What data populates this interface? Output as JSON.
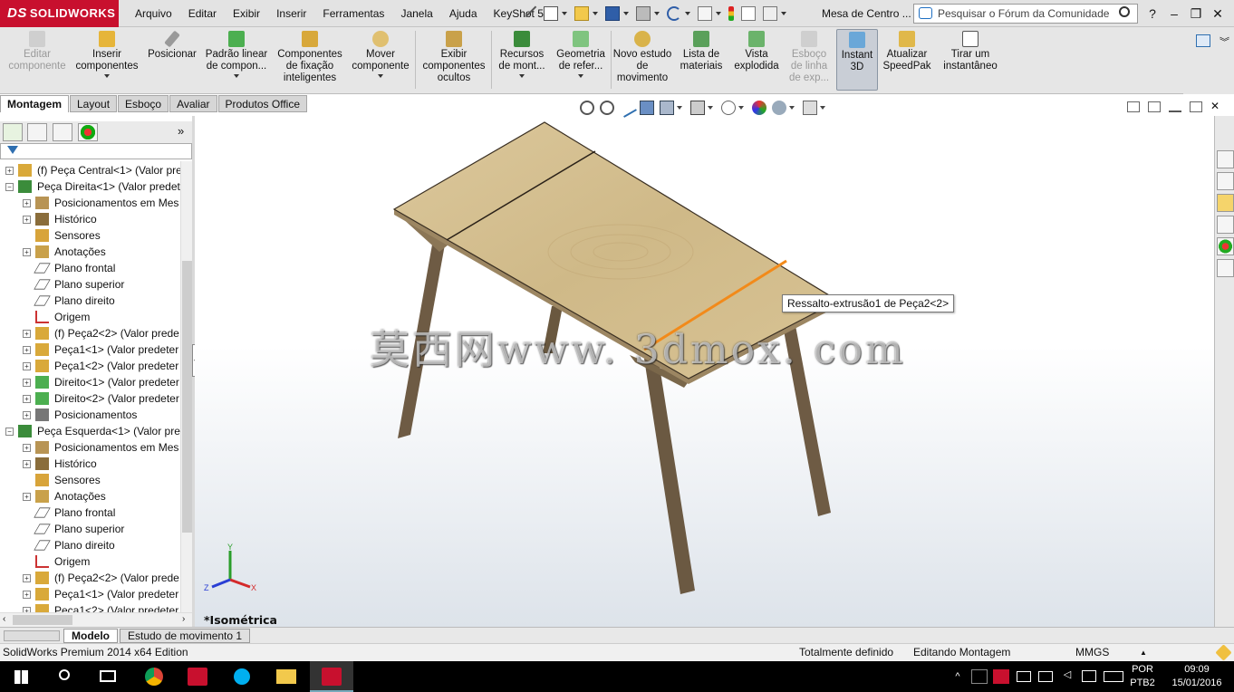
{
  "app": {
    "brand": "SOLIDWORKS",
    "brand_mark": "DS",
    "brand_color": "#c8102e"
  },
  "menu": [
    "Arquivo",
    "Editar",
    "Exibir",
    "Inserir",
    "Ferramentas",
    "Janela",
    "Ajuda",
    "KeyShot 5"
  ],
  "document_title": "Mesa de Centro ...",
  "search": {
    "placeholder": "Pesquisar o Fórum da Comunidade"
  },
  "command_manager": [
    {
      "label": "Editar componente",
      "icon": "edit-component-icon",
      "enabled": false
    },
    {
      "label": "Inserir componentes",
      "icon": "insert-components-icon",
      "enabled": true
    },
    {
      "label": "Posicionar",
      "icon": "mate-icon",
      "enabled": true
    },
    {
      "label": "Padrão linear de compon...",
      "icon": "linear-pattern-icon",
      "enabled": true
    },
    {
      "label": "Componentes de fixação inteligentes",
      "icon": "smart-fasteners-icon",
      "enabled": true
    },
    {
      "label": "Mover componente",
      "icon": "move-component-icon",
      "enabled": true
    },
    {
      "label": "Exibir componentes ocultos",
      "icon": "show-hidden-icon",
      "enabled": true
    },
    {
      "label": "Recursos de mont...",
      "icon": "assembly-features-icon",
      "enabled": true
    },
    {
      "label": "Geometria de refer...",
      "icon": "reference-geometry-icon",
      "enabled": true
    },
    {
      "label": "Novo estudo de movimento",
      "icon": "motion-study-icon",
      "enabled": true
    },
    {
      "label": "Lista de materiais",
      "icon": "bom-icon",
      "enabled": true
    },
    {
      "label": "Vista explodida",
      "icon": "exploded-view-icon",
      "enabled": true
    },
    {
      "label": "Esboço de linha de exp...",
      "icon": "explode-line-sketch-icon",
      "enabled": false
    },
    {
      "label": "Instant 3D",
      "icon": "instant3d-icon",
      "enabled": true,
      "active": true
    },
    {
      "label": "Atualizar SpeedPak",
      "icon": "speedpak-icon",
      "enabled": true
    },
    {
      "label": "Tirar um instantâneo",
      "icon": "snapshot-icon",
      "enabled": true
    }
  ],
  "tabs": [
    "Montagem",
    "Layout",
    "Esboço",
    "Avaliar",
    "Produtos Office"
  ],
  "active_tab": "Montagem",
  "tree": [
    {
      "label": "(f) Peça Central<1> (Valor pre",
      "level": 0,
      "icon": "part-icon"
    },
    {
      "label": "Peça Direita<1> (Valor predet",
      "level": 0,
      "icon": "subassembly-icon",
      "expanded": true
    },
    {
      "label": "Posicionamentos em Mes",
      "level": 1,
      "icon": "mates-folder-icon"
    },
    {
      "label": "Histórico",
      "level": 1,
      "icon": "history-icon"
    },
    {
      "label": "Sensores",
      "level": 1,
      "icon": "sensor-icon"
    },
    {
      "label": "Anotações",
      "level": 1,
      "icon": "annotations-icon"
    },
    {
      "label": "Plano frontal",
      "level": 1,
      "icon": "plane-icon"
    },
    {
      "label": "Plano superior",
      "level": 1,
      "icon": "plane-icon"
    },
    {
      "label": "Plano direito",
      "level": 1,
      "icon": "plane-icon"
    },
    {
      "label": "Origem",
      "level": 1,
      "icon": "origin-icon"
    },
    {
      "label": "(f) Peça2<2> (Valor prede",
      "level": 1,
      "icon": "part-icon"
    },
    {
      "label": "Peça1<1> (Valor predeter",
      "level": 1,
      "icon": "part-icon"
    },
    {
      "label": "Peça1<2> (Valor predeter",
      "level": 1,
      "icon": "part-icon"
    },
    {
      "label": "Direito<1> (Valor predeter",
      "level": 1,
      "icon": "part-green-icon"
    },
    {
      "label": "Direito<2> (Valor predeter",
      "level": 1,
      "icon": "part-green-icon"
    },
    {
      "label": "Posicionamentos",
      "level": 1,
      "icon": "mates-icon"
    },
    {
      "label": "Peça Esquerda<1> (Valor pred",
      "level": 0,
      "icon": "subassembly-icon",
      "expanded": true
    },
    {
      "label": "Posicionamentos em Mes",
      "level": 1,
      "icon": "mates-folder-icon"
    },
    {
      "label": "Histórico",
      "level": 1,
      "icon": "history-icon"
    },
    {
      "label": "Sensores",
      "level": 1,
      "icon": "sensor-icon"
    },
    {
      "label": "Anotações",
      "level": 1,
      "icon": "annotations-icon"
    },
    {
      "label": "Plano frontal",
      "level": 1,
      "icon": "plane-icon"
    },
    {
      "label": "Plano superior",
      "level": 1,
      "icon": "plane-icon"
    },
    {
      "label": "Plano direito",
      "level": 1,
      "icon": "plane-icon"
    },
    {
      "label": "Origem",
      "level": 1,
      "icon": "origin-icon"
    },
    {
      "label": "(f) Peça2<2> (Valor prede",
      "level": 1,
      "icon": "part-icon"
    },
    {
      "label": "Peça1<1> (Valor predeter",
      "level": 1,
      "icon": "part-icon"
    },
    {
      "label": "Peça1<2> (Valor predeter",
      "level": 1,
      "icon": "part-icon"
    }
  ],
  "viewport": {
    "tooltip": "Ressalto-extrusão1 de Peça2<2>",
    "watermark": "莫西网www. 3dmox. com",
    "view_orientation": "*Isométrica",
    "highlight_color": "#f28a1a",
    "wood_color": "#d9c497",
    "leg_color": "#6b5a44"
  },
  "triad": {
    "x": "X",
    "y": "Y",
    "z": "Z"
  },
  "bottom_tabs": [
    "Modelo",
    "Estudo de movimento 1"
  ],
  "active_bottom_tab": "Modelo",
  "status": {
    "edition": "SolidWorks Premium 2014 x64 Edition",
    "definition": "Totalmente definido",
    "mode": "Editando Montagem",
    "units": "MMGS"
  },
  "taskbar": {
    "language": "POR",
    "layout": "PTB2",
    "time": "09:09",
    "date": "15/01/2016"
  }
}
